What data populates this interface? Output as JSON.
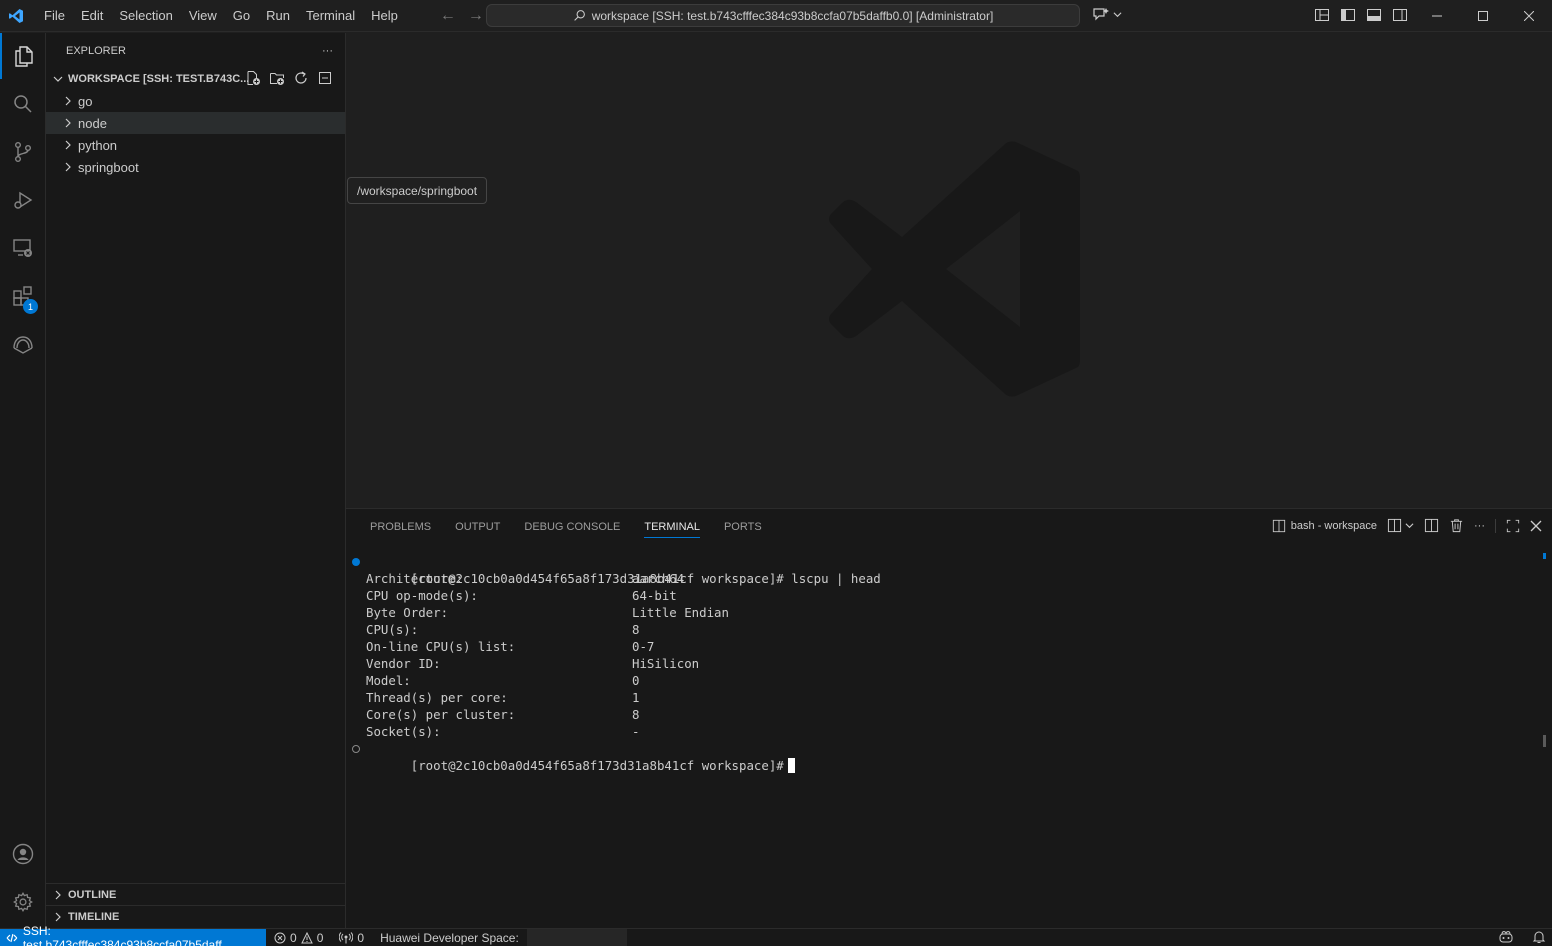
{
  "menu": [
    "File",
    "Edit",
    "Selection",
    "View",
    "Go",
    "Run",
    "Terminal",
    "Help"
  ],
  "command_center": "workspace [SSH: test.b743cfffec384c93b8ccfa07b5daffb0.0] [Administrator]",
  "explorer": {
    "title": "EXPLORER",
    "more": "···",
    "workspace_label": "WORKSPACE [SSH: TEST.B743C...",
    "items": [
      {
        "label": "go"
      },
      {
        "label": "node"
      },
      {
        "label": "python"
      },
      {
        "label": "springboot"
      }
    ],
    "outline": "OUTLINE",
    "timeline": "TIMELINE"
  },
  "tooltip": "/workspace/springboot",
  "activity_badge": "1",
  "panel": {
    "tabs": [
      "PROBLEMS",
      "OUTPUT",
      "DEBUG CONSOLE",
      "TERMINAL",
      "PORTS"
    ],
    "active_tab": "TERMINAL",
    "terminal_name": "bash - workspace",
    "more": "···"
  },
  "terminal": {
    "prompt": "[root@2c10cb0a0d454f65a8f173d31a8b41cf workspace]#",
    "command": "lscpu | head",
    "rows": [
      {
        "k": "Architecture:",
        "v": "aarch64"
      },
      {
        "k": "CPU op-mode(s):",
        "v": "64-bit"
      },
      {
        "k": "Byte Order:",
        "v": "Little Endian"
      },
      {
        "k": "CPU(s):",
        "v": "8"
      },
      {
        "k": "On-line CPU(s) list:",
        "v": "0-7"
      },
      {
        "k": "Vendor ID:",
        "v": "HiSilicon"
      },
      {
        "k": "Model:",
        "v": "0"
      },
      {
        "k": "Thread(s) per core:",
        "v": "1"
      },
      {
        "k": "Core(s) per cluster:",
        "v": "8"
      },
      {
        "k": "Socket(s):",
        "v": "-"
      }
    ]
  },
  "status": {
    "remote": "SSH: test.b743cfffec384c93b8ccfa07b5daff...",
    "errors": "0",
    "warnings": "0",
    "ports": "0",
    "space": "Huawei Developer Space:"
  },
  "colors": {
    "accent": "#0078d4",
    "background": "#1f1f1f",
    "sidebar": "#181818"
  }
}
